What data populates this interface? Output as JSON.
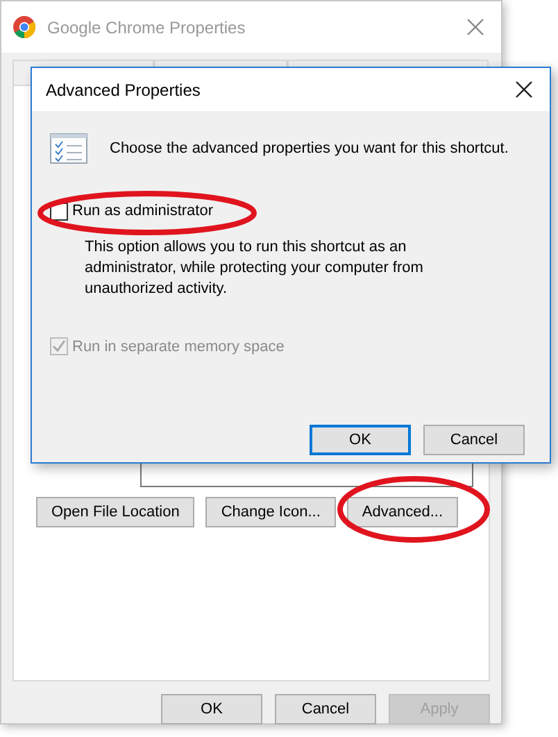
{
  "back_window": {
    "title": "Google Chrome Properties",
    "buttons": [
      {
        "label": "Open File Location"
      },
      {
        "label": "Change Icon..."
      },
      {
        "label": "Advanced..."
      }
    ],
    "footer_buttons": [
      {
        "label": "OK",
        "disabled": false
      },
      {
        "label": "Cancel",
        "disabled": false
      },
      {
        "label": "Apply",
        "disabled": true
      }
    ]
  },
  "dialog": {
    "title": "Advanced Properties",
    "intro": "Choose the advanced properties you want for this shortcut.",
    "options": [
      {
        "label": "Run as administrator",
        "checked": false,
        "disabled": false,
        "description": "This option allows you to run this shortcut as an administrator, while protecting your computer from unauthorized activity."
      },
      {
        "label": "Run in separate memory space",
        "checked": true,
        "disabled": true
      }
    ],
    "buttons": [
      {
        "label": "OK",
        "default": true
      },
      {
        "label": "Cancel",
        "default": false
      }
    ]
  }
}
